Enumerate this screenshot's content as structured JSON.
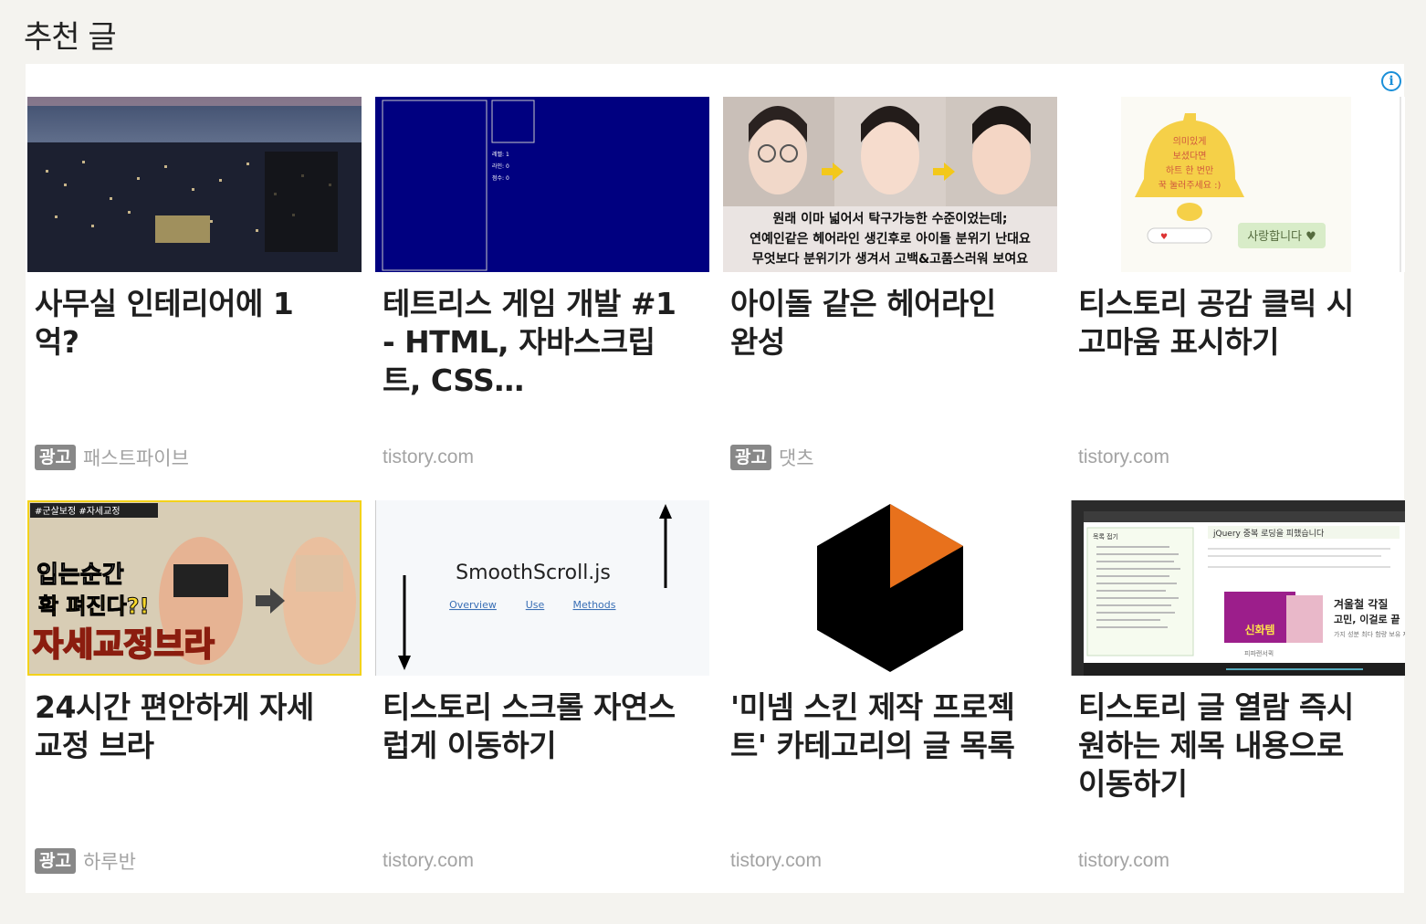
{
  "section": {
    "title": "추천 글"
  },
  "info_icon": "i",
  "cards": [
    {
      "title": "사무실 인테리어에 1억?",
      "ad_badge": "광고",
      "source": "패스트파이브",
      "is_ad": true
    },
    {
      "title": "테트리스 게임 개발 #1 - HTML, 자바스크립트, CSS…",
      "source": "tistory.com",
      "is_ad": false,
      "thumb_text": [
        "레벨: 1",
        "라인: 0",
        "점수: 0"
      ]
    },
    {
      "title": "아이돌 같은 헤어라인 완성",
      "ad_badge": "광고",
      "source": "댓츠",
      "is_ad": true,
      "thumb_text": [
        "원래 이마 넓어서 탁구가능한 수준이었는데;",
        "연예인같은 헤어라인 생긴후로 아이돌 분위기 난대요",
        "무엇보다 분위기가 생겨서 고백&고품스러워 보여요"
      ]
    },
    {
      "title": "티스토리 공감 클릭 시 고마움 표시하기",
      "source": "tistory.com",
      "is_ad": false,
      "thumb_text": [
        "의미있게",
        "보셨다면",
        "하트 한 번만",
        "꾹 눌러주세요 :)",
        "사랑합니다 ♥"
      ]
    },
    {
      "title": "24시간 편안하게 자세교정 브라",
      "ad_badge": "광고",
      "source": "하루반",
      "is_ad": true,
      "thumb_text": [
        "#군살보정 #자세교정",
        "입는순간",
        "확 펴진다?!",
        "자세교정브라"
      ]
    },
    {
      "title": "티스토리 스크롤 자연스럽게 이동하기",
      "source": "tistory.com",
      "is_ad": false,
      "thumb_text": [
        "SmoothScroll.js",
        "Overview",
        "Use",
        "Methods"
      ]
    },
    {
      "title": "'미넴 스킨 제작 프로젝트' 카테고리의 글 목록",
      "source": "tistory.com",
      "is_ad": false
    },
    {
      "title": "티스토리 글 열람 즉시 원하는 제목 내용으로 이동하기",
      "source": "tistory.com",
      "is_ad": false,
      "thumb_text": [
        "목록 접기",
        "jQuery 중복 로딩을 피했습니다",
        "겨울철 각질",
        "고민, 이걸로 끝",
        "가지 성분 최다 함량 보유 제품",
        "신화템",
        "피파랜서퀵"
      ]
    }
  ],
  "colors": {
    "accent_info": "#1a8fd8",
    "tetris_bg": "#000080",
    "thumb_orange": "#e8711c",
    "bell_yellow": "#f5d048",
    "ad_badge_bg": "#888888"
  }
}
